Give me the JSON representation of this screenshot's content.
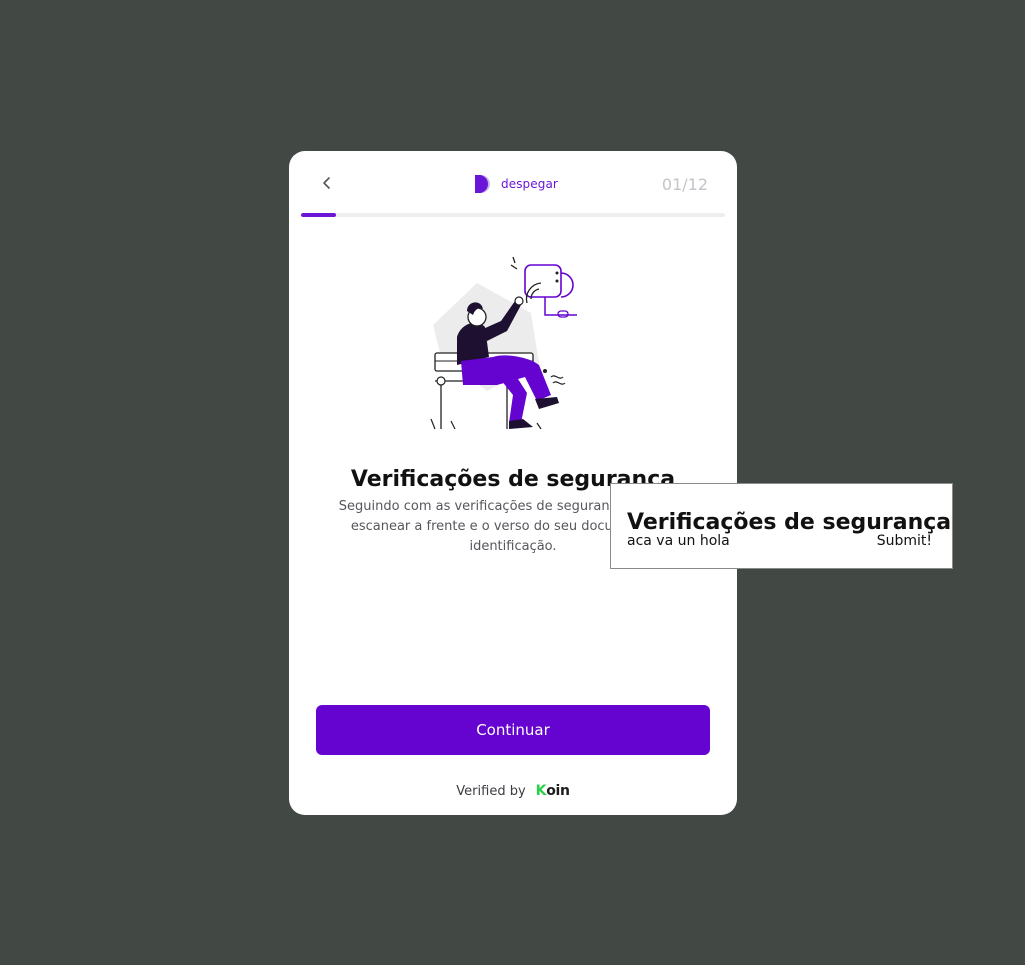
{
  "header": {
    "brand_name": "despegar",
    "step_counter": "01/12",
    "progress": 0.083
  },
  "content": {
    "title": "Verificações de segurança",
    "subtitle": "Seguindo com as verificações de segurança, você vai escanear a frente e o verso do seu documento de identificação."
  },
  "actions": {
    "continue_label": "Continuar"
  },
  "footer": {
    "verified_label": "Verified by",
    "koin_k": "K",
    "koin_rest": "oin"
  },
  "popup": {
    "title": "Verificações de segurança",
    "text": "aca va un hola",
    "submit_label": "Submit!"
  },
  "colors": {
    "accent": "#6503d0",
    "backdrop": "#424844",
    "koin_green": "#2bd04a"
  },
  "icons": {
    "back": "chevron-left-icon",
    "brand": "despegar-logo-icon"
  }
}
